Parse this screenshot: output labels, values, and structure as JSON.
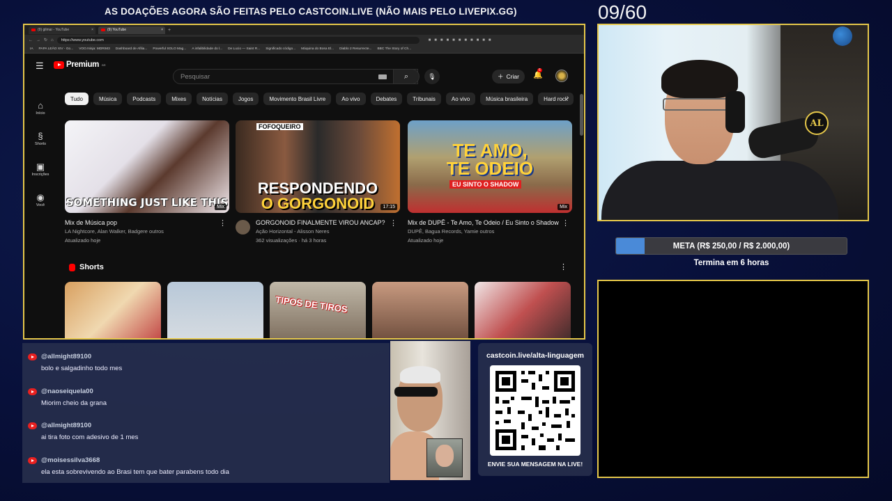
{
  "banner": "AS DOAÇÕES AGORA SÃO FEITAS PELO CASTCOIN.LIVE (NÃO MAIS PELO LIVEPIX.GG)",
  "counter": "09/60",
  "browser": {
    "tabs": [
      "(9) gilmar - YouTube",
      "(9) YouTube"
    ],
    "url": "https://www.youtube.com",
    "bookmarks": [
      "IA",
      "PAPA LEÃO XIV - Go...",
      "VOO.Ninja: MDRIM3",
      "Dashboard de Afilia...",
      "Powerful SOLO Mag...",
      "A infalibilidade do l...",
      "De Lucio — Saint R...",
      "Significado código...",
      "Máquina do Bosa El...",
      "Diablo 2 Resurrecte...",
      "BBC The Story of Ch..."
    ]
  },
  "youtube": {
    "logo": "Premium",
    "logo_sup": "BR",
    "search_placeholder": "Pesquisar",
    "create_label": "Criar",
    "notification_count": "6",
    "sidebar": [
      {
        "icon": "home-icon",
        "glyph": "⌂",
        "label": "Início"
      },
      {
        "icon": "shorts-icon",
        "glyph": "§",
        "label": "Shorts"
      },
      {
        "icon": "subscriptions-icon",
        "glyph": "▣",
        "label": "Inscrições"
      },
      {
        "icon": "you-icon",
        "glyph": "◉",
        "label": "Você"
      }
    ],
    "chips": [
      "Tudo",
      "Música",
      "Podcasts",
      "Mixes",
      "Notícias",
      "Jogos",
      "Movimento Brasil Livre",
      "Ao vivo",
      "Debates",
      "Tribunais",
      "Ao vivo",
      "Música brasileira",
      "Hard rock"
    ],
    "videos": [
      {
        "title": "Mix de Música pop",
        "meta1": "LA Nightcore, Alan Walker, Badgere outros",
        "meta2": "Atualizado hoje",
        "overlay": "SOMETHING JUST LIKE THIS",
        "badge": "Mix"
      },
      {
        "title": "GORGONOID FINALMENTE VIROU ANCAP?",
        "meta1": "Ação Horizontal - Alisson Neres",
        "meta2": "362 visualizações · há 3 horas",
        "overlay_top": "FOFOQUEIRO",
        "overlay_line1": "RESPONDENDO",
        "overlay_line2": "O GORGONOID",
        "badge": "17:15"
      },
      {
        "title": "Mix de DUPÊ - Te Amo, Te Odeio / Eu Sinto o Shadow",
        "meta1": "DUPÊ, Bagua Records, Yamie outros",
        "meta2": "Atualizado hoje",
        "overlay_line1": "TE AMO,",
        "overlay_line2": "TE ODEIO",
        "overlay_sub": "EU SINTO O SHADOW",
        "badge": "Mix"
      }
    ],
    "shorts_title": "Shorts",
    "shorts_label_3": "TIPOS DE TIROS"
  },
  "goal": {
    "text": "META (R$ 250,00 / R$ 2.000,00)",
    "progress": 0.125,
    "subtitle": "Termina em 6 horas"
  },
  "chat": [
    {
      "user": "@allmight89100",
      "text": "bolo e salgadinho todo mes"
    },
    {
      "user": "@naoseiquela00",
      "text": "Miorim cheio da grana"
    },
    {
      "user": "@allmight89100",
      "text": "ai tira foto com adesivo de 1 mes"
    },
    {
      "user": "@moisessilva3668",
      "text": "ela esta sobrevivendo ao Brasi tem que bater parabens todo dia"
    }
  ],
  "qr": {
    "url": "castcoin.live/alta-linguagem",
    "caption": "ENVIE SUA MENSAGEM NA LIVE!"
  },
  "webcam_logo": "AL"
}
